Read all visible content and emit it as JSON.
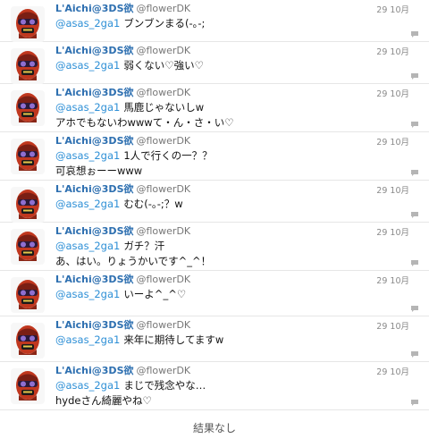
{
  "tweets": [
    {
      "name": "L'Aichi@3DS欲",
      "handle": "@flowerDK",
      "date": "29 10月",
      "mention": "@asas_2ga1",
      "text": "ブンブンまる(-｡-;",
      "text2": ""
    },
    {
      "name": "L'Aichi@3DS欲",
      "handle": "@flowerDK",
      "date": "29 10月",
      "mention": "@asas_2ga1",
      "text": "弱くない♡強い♡",
      "text2": ""
    },
    {
      "name": "L'Aichi@3DS欲",
      "handle": "@flowerDK",
      "date": "29 10月",
      "mention": "@asas_2ga1",
      "text": "馬鹿じゃないしw",
      "text2": "アホでもないわwwwて・ん・さ・い♡"
    },
    {
      "name": "L'Aichi@3DS欲",
      "handle": "@flowerDK",
      "date": "29 10月",
      "mention": "@asas_2ga1",
      "text": "1人で行くの一？？",
      "text2": "可哀想ぉーーwww"
    },
    {
      "name": "L'Aichi@3DS欲",
      "handle": "@flowerDK",
      "date": "29 10月",
      "mention": "@asas_2ga1",
      "text": "むむ(-｡-;？w",
      "text2": ""
    },
    {
      "name": "L'Aichi@3DS欲",
      "handle": "@flowerDK",
      "date": "29 10月",
      "mention": "@asas_2ga1",
      "text": "ガチ？汗",
      "text2": "あ、はい。りょうかいです^_^！"
    },
    {
      "name": "L'Aichi@3DS欲",
      "handle": "@flowerDK",
      "date": "29 10月",
      "mention": "@asas_2ga1",
      "text": "いーよ^_^♡",
      "text2": ""
    },
    {
      "name": "L'Aichi@3DS欲",
      "handle": "@flowerDK",
      "date": "29 10月",
      "mention": "@asas_2ga1",
      "text": "来年に期待してますw",
      "text2": ""
    },
    {
      "name": "L'Aichi@3DS欲",
      "handle": "@flowerDK",
      "date": "29 10月",
      "mention": "@asas_2ga1",
      "text": "まじで残念やな…",
      "text2": "hydeさん綺麗やね♡"
    }
  ],
  "footer": {
    "text": "結果なし"
  },
  "icons": {
    "avatar": "robot-avatar-icon",
    "reply": "reply-bubble-icon"
  },
  "colors": {
    "name": "#2d6fb0",
    "mention": "#2d8fd6",
    "handle": "#777777",
    "date": "#8a8a8a",
    "divider": "#e6e6e6"
  }
}
